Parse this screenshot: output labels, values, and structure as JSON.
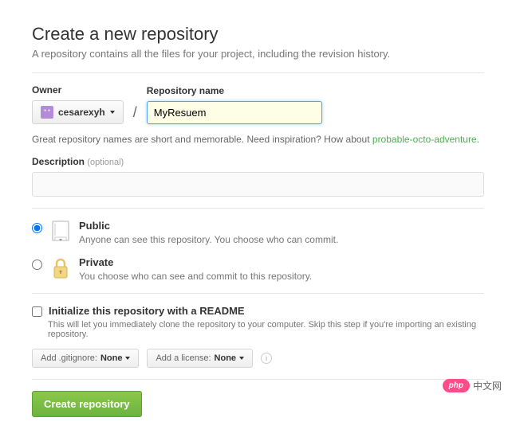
{
  "title": "Create a new repository",
  "subtitle": "A repository contains all the files for your project, including the revision history.",
  "owner": {
    "label": "Owner",
    "username": "cesarexyh"
  },
  "separator": "/",
  "repo": {
    "label": "Repository name",
    "value": "MyResuem"
  },
  "name_hint": {
    "prefix": "Great repository names are short and memorable. Need inspiration? How about ",
    "suggestion": "probable-octo-adventure",
    "suffix": "."
  },
  "description": {
    "label": "Description",
    "optional": "(optional)",
    "value": ""
  },
  "visibility": {
    "public": {
      "title": "Public",
      "desc": "Anyone can see this repository. You choose who can commit.",
      "checked": true
    },
    "private": {
      "title": "Private",
      "desc": "You choose who can see and commit to this repository.",
      "checked": false
    }
  },
  "readme": {
    "label": "Initialize this repository with a README",
    "hint": "This will let you immediately clone the repository to your computer. Skip this step if you're importing an existing repository.",
    "checked": false
  },
  "gitignore": {
    "prefix": "Add .gitignore: ",
    "value": "None"
  },
  "license": {
    "prefix": "Add a license: ",
    "value": "None"
  },
  "submit": "Create repository",
  "watermark": {
    "pill": "php",
    "text": "中文网"
  }
}
